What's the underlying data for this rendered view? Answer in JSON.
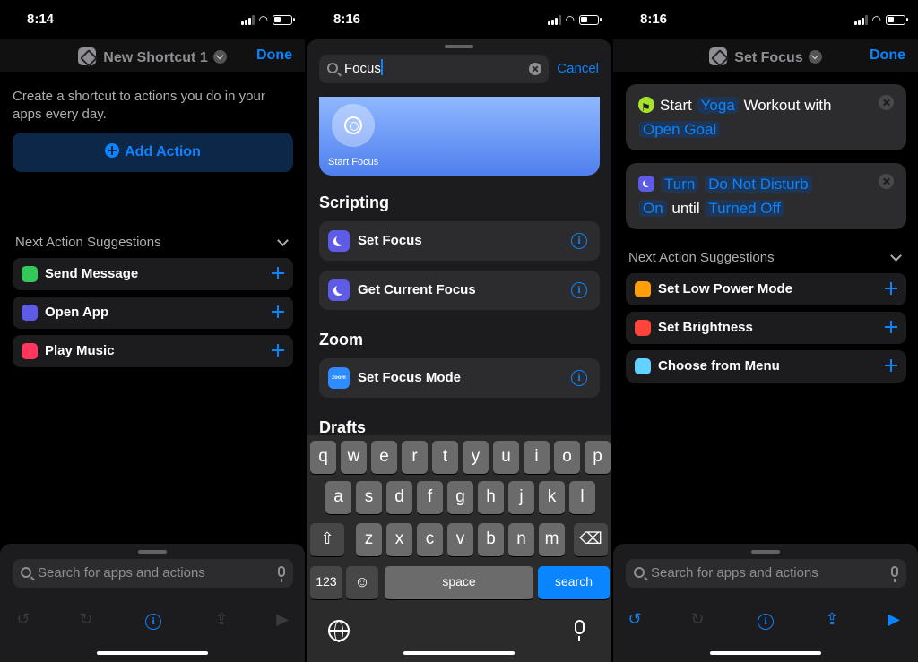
{
  "panel1": {
    "time": "8:14",
    "nav": {
      "title": "New Shortcut 1",
      "done": "Done"
    },
    "intro": "Create a shortcut to actions you do in your apps every day.",
    "add_action": "Add Action",
    "suggestions_header": "Next Action Suggestions",
    "suggestions": [
      {
        "label": "Send Message",
        "icon": "messages-icon",
        "color": "#34c759"
      },
      {
        "label": "Open App",
        "icon": "open-app-icon",
        "color": "#5e5ce6"
      },
      {
        "label": "Play Music",
        "icon": "music-icon",
        "color": "#ff375f"
      }
    ],
    "search_placeholder": "Search for apps and actions"
  },
  "panel2": {
    "time": "8:16",
    "search_value": "Focus",
    "cancel": "Cancel",
    "top_card_label": "Start Focus",
    "sections": [
      {
        "title": "Scripting",
        "items": [
          "Set Focus",
          "Get Current Focus"
        ]
      },
      {
        "title": "Zoom",
        "items": [
          "Set Focus Mode"
        ]
      },
      {
        "title": "Drafts",
        "items": []
      }
    ],
    "zoom_icon_text": "zoom",
    "keyboard": {
      "row1": [
        "q",
        "w",
        "e",
        "r",
        "t",
        "y",
        "u",
        "i",
        "o",
        "p"
      ],
      "row2": [
        "a",
        "s",
        "d",
        "f",
        "g",
        "h",
        "j",
        "k",
        "l"
      ],
      "row3": [
        "z",
        "x",
        "c",
        "v",
        "b",
        "n",
        "m"
      ],
      "numbers": "123",
      "space": "space",
      "search": "search"
    }
  },
  "panel3": {
    "time": "8:16",
    "nav": {
      "title": "Set Focus",
      "done": "Done"
    },
    "action1": {
      "start": "Start",
      "token1": "Yoga",
      "mid": "Workout with",
      "token2": "Open Goal"
    },
    "action2": {
      "turn": "Turn",
      "token1": "Do Not Disturb",
      "token2": "On",
      "until": "until",
      "token3": "Turned Off"
    },
    "suggestions_header": "Next Action Suggestions",
    "suggestions": [
      {
        "label": "Set Low Power Mode",
        "icon": "battery-icon",
        "color": "#ff9f0a"
      },
      {
        "label": "Set Brightness",
        "icon": "brightness-icon",
        "color": "#ff453a"
      },
      {
        "label": "Choose from Menu",
        "icon": "menu-icon",
        "color": "#64d2ff"
      }
    ],
    "search_placeholder": "Search for apps and actions"
  }
}
